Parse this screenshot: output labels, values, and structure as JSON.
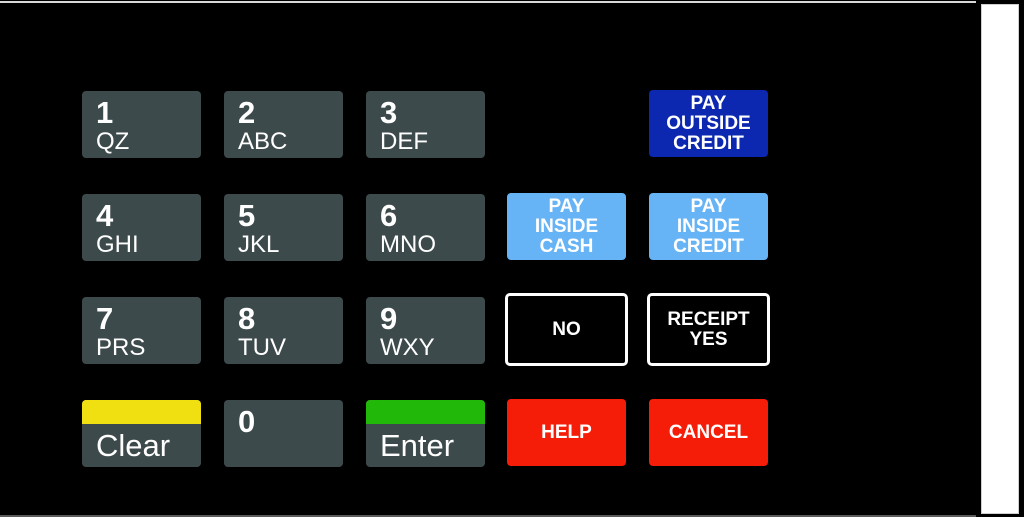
{
  "keypad": {
    "numeric_keys": [
      {
        "digit": "1",
        "letters": "QZ"
      },
      {
        "digit": "2",
        "letters": "ABC"
      },
      {
        "digit": "3",
        "letters": "DEF"
      },
      {
        "digit": "4",
        "letters": "GHI"
      },
      {
        "digit": "5",
        "letters": "JKL"
      },
      {
        "digit": "6",
        "letters": "MNO"
      },
      {
        "digit": "7",
        "letters": "PRS"
      },
      {
        "digit": "8",
        "letters": "TUV"
      },
      {
        "digit": "9",
        "letters": "WXY"
      },
      {
        "digit": "0",
        "letters": ""
      }
    ],
    "clear": {
      "label": "Clear",
      "stripe_color": "#f0e012"
    },
    "enter": {
      "label": "Enter",
      "stripe_color": "#22b80a"
    },
    "pay_outside_credit": {
      "label": "PAY\nOUTSIDE\nCREDIT",
      "color": "#0c28b0"
    },
    "pay_inside_cash": {
      "label": "PAY\nINSIDE\nCASH",
      "color": "#66b3f5"
    },
    "pay_inside_credit": {
      "label": "PAY\nINSIDE\nCREDIT",
      "color": "#66b3f5"
    },
    "no": {
      "label": "NO"
    },
    "receipt_yes": {
      "label": "RECEIPT\nYES"
    },
    "help": {
      "label": "HELP",
      "color": "#f51c08"
    },
    "cancel": {
      "label": "CANCEL",
      "color": "#f51c08"
    }
  },
  "colors": {
    "key_gray": "#3d4a4b",
    "background": "#000000"
  }
}
